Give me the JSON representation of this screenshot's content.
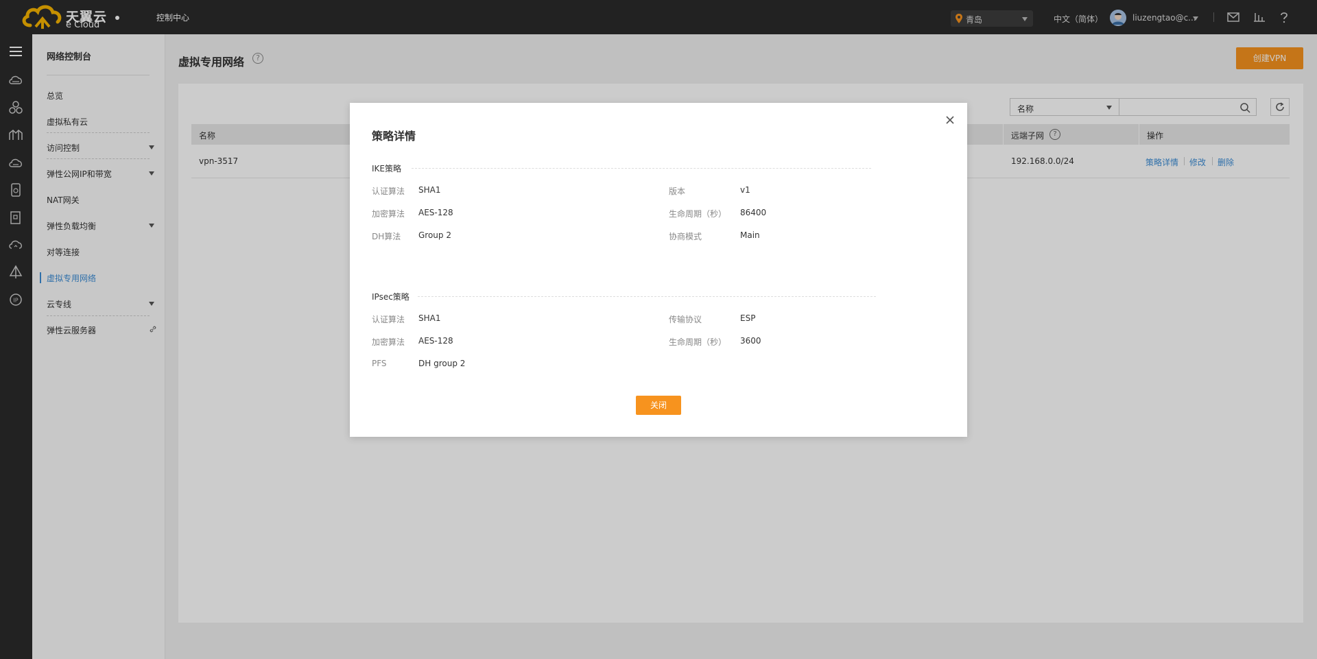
{
  "header": {
    "logo_cn": "天翼云",
    "logo_en": "e Cloud",
    "console_label": "控制中心",
    "region": "青岛",
    "language": "中文（简体）",
    "username": "liuzengtao@c..."
  },
  "sidebar": {
    "title": "网络控制台",
    "items": [
      {
        "label": "总览"
      },
      {
        "label": "虚拟私有云"
      },
      {
        "label": "访问控制"
      },
      {
        "label": "弹性公网IP和带宽"
      },
      {
        "label": "NAT网关"
      },
      {
        "label": "弹性负载均衡"
      },
      {
        "label": "对等连接"
      },
      {
        "label": "虚拟专用网络"
      },
      {
        "label": "云专线"
      },
      {
        "label": "弹性云服务器"
      }
    ]
  },
  "main": {
    "title": "虚拟专用网络",
    "help": "?",
    "create_button": "创建VPN",
    "filter_select": "名称",
    "search_placeholder": "",
    "columns": [
      "名称",
      "远端子网",
      "操作"
    ],
    "rows": [
      {
        "name": "vpn-3517",
        "remote_subnet": "192.168.0.0/24",
        "actions": [
          "策略详情",
          "修改",
          "删除"
        ]
      }
    ]
  },
  "modal": {
    "title": "策略详情",
    "ike": {
      "section": "IKE策略",
      "auth_label": "认证算法",
      "auth_value": "SHA1",
      "enc_label": "加密算法",
      "enc_value": "AES-128",
      "dh_label": "DH算法",
      "dh_value": "Group 2",
      "version_label": "版本",
      "version_value": "v1",
      "lifetime_label": "生命周期（秒）",
      "lifetime_value": "86400",
      "mode_label": "协商模式",
      "mode_value": "Main"
    },
    "ipsec": {
      "section": "IPsec策略",
      "auth_label": "认证算法",
      "auth_value": "SHA1",
      "enc_label": "加密算法",
      "enc_value": "AES-128",
      "pfs_label": "PFS",
      "pfs_value": "DH group 2",
      "proto_label": "传输协议",
      "proto_value": "ESP",
      "lifetime_label": "生命周期（秒）",
      "lifetime_value": "3600"
    },
    "close_button": "关闭"
  },
  "colors": {
    "accent": "#f7931e",
    "link": "#3c8dd5",
    "topbar": "#2b2b2b"
  }
}
